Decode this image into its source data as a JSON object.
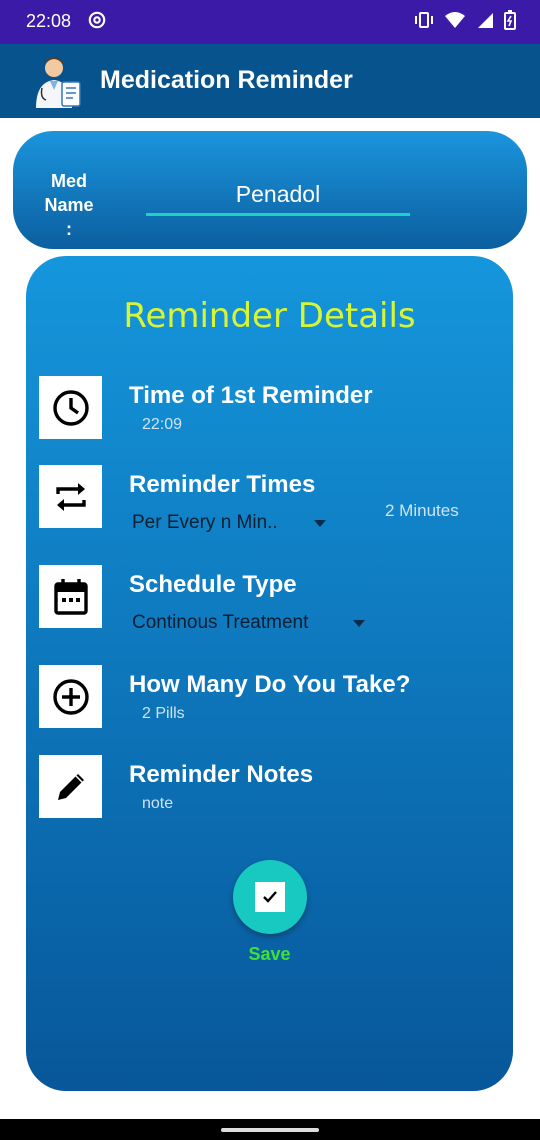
{
  "status_bar": {
    "time": "22:08"
  },
  "app_bar": {
    "title": "Medication Reminder"
  },
  "med_name": {
    "label": "Med Name :",
    "value": "Penadol"
  },
  "details": {
    "title": "Reminder Details",
    "rows": [
      {
        "title": "Time of 1st Reminder",
        "value": "22:09",
        "icon": "clock-icon"
      },
      {
        "title": "Reminder Times",
        "selected": "Per Every n Min..",
        "value": "2 Minutes",
        "icon": "repeat-icon"
      },
      {
        "title": "Schedule Type",
        "selected": "Continous Treatment",
        "icon": "calendar-icon"
      },
      {
        "title": "How Many Do You Take?",
        "value": "2 Pills",
        "icon": "add-circle-icon"
      },
      {
        "title": "Reminder Notes",
        "value": "note",
        "icon": "pencil-icon"
      }
    ]
  },
  "save": {
    "label": "Save"
  },
  "colors": {
    "status_bar": "#3a1aa6",
    "app_bar": "#07538d",
    "title_accent": "#d8f535",
    "save_button": "#17c9c1",
    "save_label": "#40e03a"
  }
}
